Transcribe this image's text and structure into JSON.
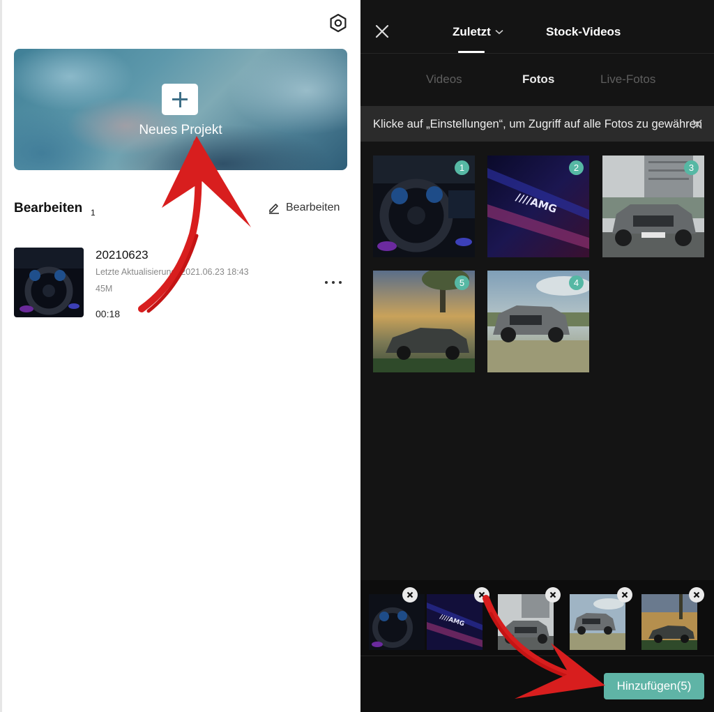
{
  "left": {
    "banner": {
      "label": "Neues Projekt"
    },
    "section": {
      "title": "Bearbeiten",
      "count": "1",
      "edit_label": "Bearbeiten"
    },
    "project": {
      "name": "20210623",
      "meta": "Letzte Aktualisierung: 2021.06.23 18:43",
      "size": "45M",
      "duration": "00:18"
    }
  },
  "right": {
    "tabs": {
      "recent": "Zuletzt",
      "stock": "Stock-Videos"
    },
    "subtabs": {
      "videos": "Videos",
      "photos": "Fotos",
      "live": "Live-Fotos"
    },
    "notice": "Klicke auf „Einstellungen“, um Zugriff auf alle Fotos zu gewähren",
    "photos": [
      {
        "badge": "1",
        "subject": "steering-wheel-dashboard"
      },
      {
        "badge": "2",
        "subject": "amg-door-sill"
      },
      {
        "badge": "3",
        "subject": "grey-suv-front"
      },
      {
        "badge": "5",
        "subject": "suv-coupe-sunset"
      },
      {
        "badge": "4",
        "subject": "suv-front-field"
      }
    ],
    "add_button": "Hinzufügen(5)"
  },
  "colors": {
    "accent": "#5fb4a6",
    "badge": "#56b8a4",
    "dark_bg": "#141414",
    "annotation_arrow": "#d81e1e"
  }
}
